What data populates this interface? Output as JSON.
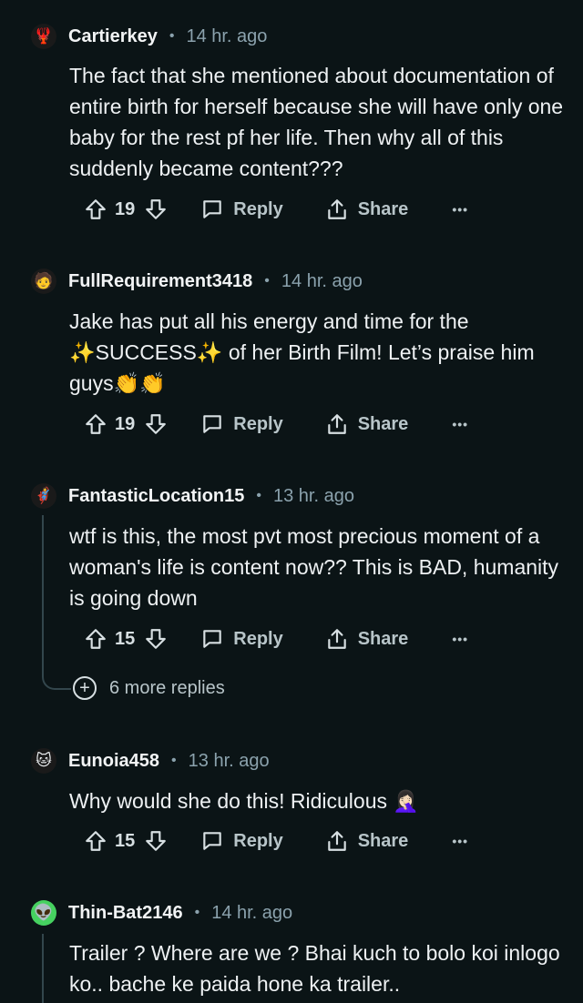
{
  "labels": {
    "reply": "Reply",
    "share": "Share",
    "more": "•••"
  },
  "comments": [
    {
      "user": "Cartierkey",
      "time": "14 hr. ago",
      "avatar_icon": "🦞",
      "avatar_color": "#1a1a1a",
      "text": "The fact that she mentioned about documentation of entire birth for herself because she will have only one baby for the rest pf her life. Then why all of this suddenly became content???",
      "score": "19"
    },
    {
      "user": "FullRequirement3418",
      "time": "14 hr. ago",
      "avatar_icon": "🧑",
      "avatar_color": "#1a1a1a",
      "text": "Jake has put all his energy and time for the ✨SUCCESS✨ of her Birth Film! Let’s praise him guys👏👏",
      "score": "19"
    },
    {
      "user": "FantasticLocation15",
      "time": "13 hr. ago",
      "avatar_icon": "🦸",
      "avatar_color": "#1a1a1a",
      "text": "wtf is this, the most pvt most precious moment of a woman's life is content now?? This is BAD, humanity is going down",
      "score": "15",
      "more_replies": "6 more replies"
    },
    {
      "user": "Eunoia458",
      "time": "13 hr. ago",
      "avatar_icon": "🐱",
      "avatar_color": "#1a1a1a",
      "text": "Why would she do this! Ridiculous 🤦🏻‍♀️",
      "score": "15"
    },
    {
      "user": "Thin-Bat2146",
      "time": "14 hr. ago",
      "avatar_icon": "👽",
      "avatar_color": "#46d160",
      "text": "Trailer ? Where are we ? Bhai kuch to bolo koi inlogo ko.. bache ke paida hone ka trailer.."
    }
  ]
}
